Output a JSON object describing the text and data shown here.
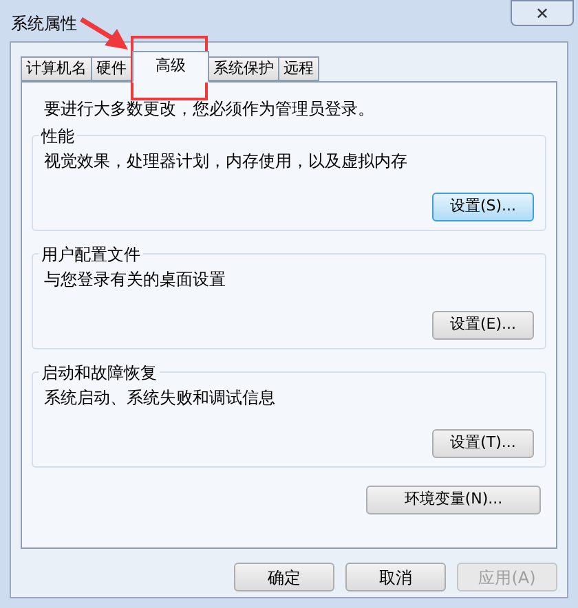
{
  "window": {
    "title": "系统属性",
    "close": "✕"
  },
  "tabs": [
    {
      "label": "计算机名",
      "selected": false
    },
    {
      "label": "硬件",
      "selected": false
    },
    {
      "label": "高级",
      "selected": true
    },
    {
      "label": "系统保护",
      "selected": false
    },
    {
      "label": "远程",
      "selected": false
    }
  ],
  "notice": "要进行大多数更改，您必须作为管理员登录。",
  "groups": [
    {
      "title": "性能",
      "description": "视觉效果，处理器计划，内存使用，以及虚拟内存",
      "button": "设置(S)...",
      "focused": true
    },
    {
      "title": "用户配置文件",
      "description": "与您登录有关的桌面设置",
      "button": "设置(E)...",
      "focused": false
    },
    {
      "title": "启动和故障恢复",
      "description": "系统启动、系统失败和调试信息",
      "button": "设置(T)...",
      "focused": false
    }
  ],
  "env_button": "环境变量(N)...",
  "buttons": [
    {
      "label": "确定",
      "disabled": false
    },
    {
      "label": "取消",
      "disabled": false
    },
    {
      "label": "应用(A)",
      "disabled": true
    }
  ]
}
